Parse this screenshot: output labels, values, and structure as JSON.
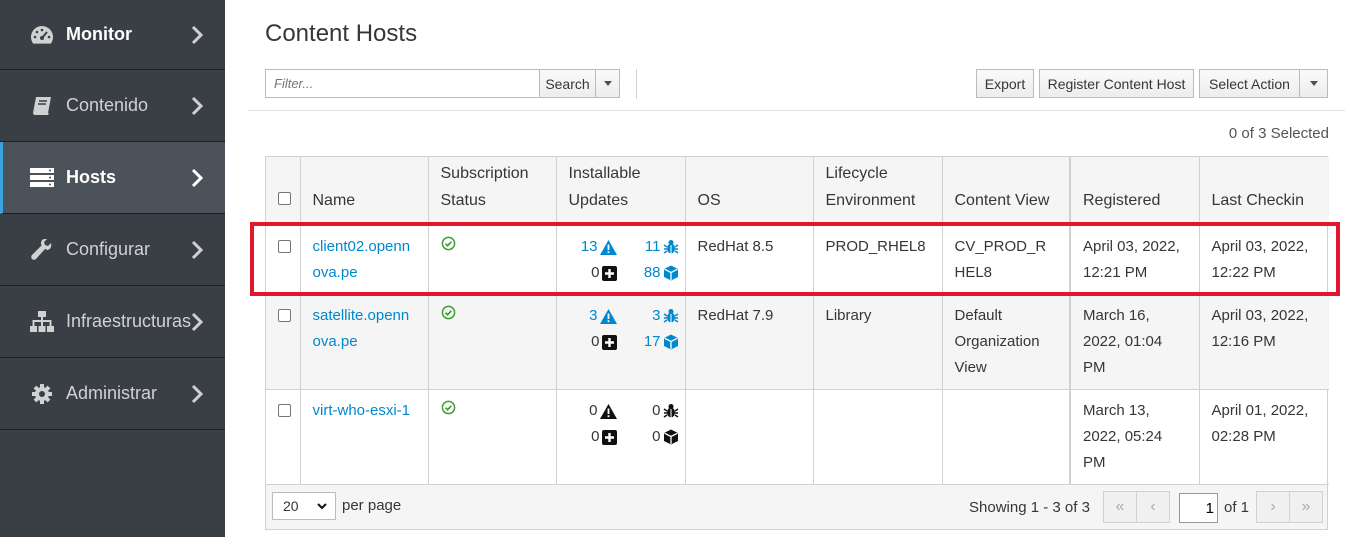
{
  "sidebar": {
    "items": [
      {
        "label": "Monitor",
        "icon": "dashboard-icon"
      },
      {
        "label": "Contenido",
        "icon": "book-icon"
      },
      {
        "label": "Hosts",
        "icon": "server-icon"
      },
      {
        "label": "Configurar",
        "icon": "wrench-icon"
      },
      {
        "label": "Infraestructuras",
        "icon": "sitemap-icon"
      },
      {
        "label": "Administrar",
        "icon": "gear-icon"
      }
    ]
  },
  "page": {
    "title": "Content Hosts"
  },
  "toolbar": {
    "filter_placeholder": "Filter...",
    "search_label": "Search",
    "export_label": "Export",
    "register_label": "Register Content Host",
    "select_action_label": "Select Action"
  },
  "selected_count": "0 of 3 Selected",
  "table": {
    "headers": [
      "Name",
      "Subscription Status",
      "Installable Updates",
      "OS",
      "Lifecycle Environment",
      "Content View",
      "Registered",
      "Last Checkin"
    ],
    "rows": [
      {
        "name": "client02.opennova.pe",
        "security": "13",
        "bugfix": "11",
        "enhancement": "0",
        "packages": "88",
        "os": "RedHat 8.5",
        "lifecycle": "PROD_RHEL8",
        "content_view": "CV_PROD_RHEL8",
        "registered": "April 03, 2022, 12:21 PM",
        "last_checkin": "April 03, 2022, 12:22 PM"
      },
      {
        "name": "satellite.opennova.pe",
        "security": "3",
        "bugfix": "3",
        "enhancement": "0",
        "packages": "17",
        "os": "RedHat 7.9",
        "lifecycle": "Library",
        "content_view": "Default Organization View",
        "registered": "March 16, 2022, 01:04 PM",
        "last_checkin": "April 03, 2022, 12:16 PM"
      },
      {
        "name": "virt-who-esxi-1",
        "security": "0",
        "bugfix": "0",
        "enhancement": "0",
        "packages": "0",
        "os": "",
        "lifecycle": "",
        "content_view": "",
        "registered": "March 13, 2022, 05:24 PM",
        "last_checkin": "April 01, 2022, 02:28 PM"
      }
    ]
  },
  "footer": {
    "per_page_value": "20",
    "per_page_label": "per page",
    "showing": "Showing 1 - 3 of 3",
    "page_input": "1",
    "page_of": "of 1"
  },
  "colors": {
    "sidebar_bg": "#393f44",
    "link": "#0088ce",
    "highlight": "#e2172b",
    "success": "#3f9c35"
  }
}
